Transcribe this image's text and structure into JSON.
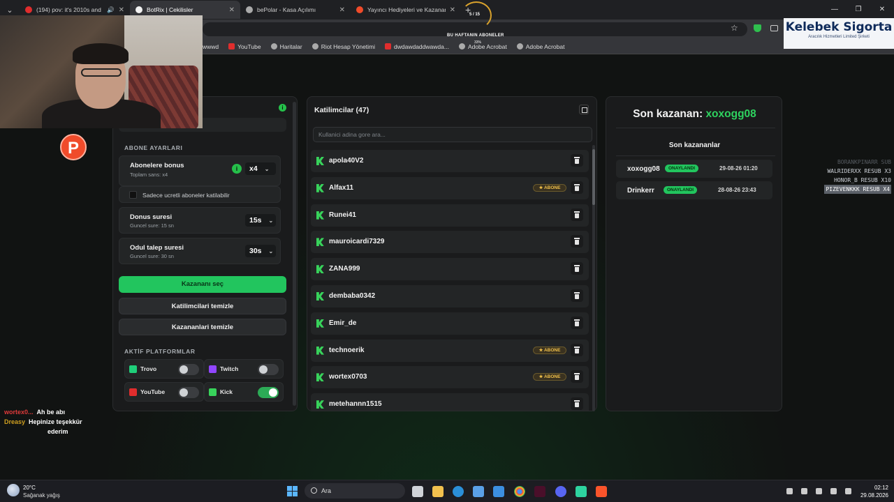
{
  "browser": {
    "tabs": [
      {
        "title": "(194) pov: it's 2010s and y...",
        "color": "#e02d2d",
        "active": false
      },
      {
        "title": "BotRix | Cekilisler",
        "color": "#f2f2f2",
        "active": true
      },
      {
        "title": "bePolar - Kasa Açılımı",
        "color": "#aaaaaa",
        "active": false
      },
      {
        "title": "Yayıncı Hediyeleri ve Kazananlar",
        "color": "#f04b2a",
        "active": false
      }
    ],
    "new_tab": "+",
    "bookmarks": [
      {
        "label": "wwwd",
        "icon": "globe-icon"
      },
      {
        "label": "YouTube",
        "icon": "youtube-icon"
      },
      {
        "label": "Haritalar",
        "icon": "globe-icon"
      },
      {
        "label": "Riot Hesap Yönetimi",
        "icon": "riot-icon"
      },
      {
        "label": "dwdawdaddwawda...",
        "icon": "youtube-icon"
      },
      {
        "label": "Adobe Acrobat",
        "icon": "globe-icon"
      },
      {
        "label": "Adobe Acrobat",
        "icon": "globe-icon"
      }
    ]
  },
  "overlay": {
    "subs_goal_count": "5 / 15",
    "subs_goal_title": "BU HAFTANIN ABONELER",
    "subs_goal_pct": "33%",
    "sponsor_name": "Kelebek Sigorta",
    "sponsor_sub": "Aracılık Hizmetleri Limited Şirketi",
    "resubs": [
      "BORANKPINARR SUB",
      "WALRIDERXX RESUB X3",
      "HONOR_B RESUB X10",
      "PIZEVENKKK RESUB X4"
    ],
    "chat": [
      {
        "user": "wortex0...",
        "message": "Ah be abı"
      },
      {
        "user": "Dreasy",
        "message": "Hepinize teşekkür"
      },
      {
        "user": "",
        "message": "ederim"
      }
    ]
  },
  "settings": {
    "section_title": "ABONE AYARLARI",
    "bonus": {
      "title": "Abonelere bonus",
      "subtitle": "Toplam sans: x4",
      "value": "x4"
    },
    "paid_only_label": "Sadece ucretli aboneler katilabilir",
    "bonus_time": {
      "title": "Donus suresi",
      "subtitle": "Guncel sure: 15 sn",
      "value": "15s"
    },
    "claim_time": {
      "title": "Odul talep suresi",
      "subtitle": "Guncel sure: 30 sn",
      "value": "30s"
    },
    "pick_winner": "Kazananı seç",
    "clear_participants": "Katilimcilari temizle",
    "clear_winners": "Kazananlari temizle",
    "platforms_title": "AKTİF PLATFORMLAR",
    "platforms": [
      {
        "name": "Trovo",
        "color": "#1fcf7a",
        "enabled": false
      },
      {
        "name": "Twitch",
        "color": "#9146ff",
        "enabled": false
      },
      {
        "name": "YouTube",
        "color": "#e02d2d",
        "enabled": false
      },
      {
        "name": "Kick",
        "color": "#38d35b",
        "enabled": true
      }
    ]
  },
  "participants": {
    "title": "Katilimcilar (47)",
    "search_placeholder": "Kullanici adina gore ara...",
    "subscriber_badge": "★ ABONE",
    "list": [
      {
        "name": "apola40V2",
        "subscriber": false
      },
      {
        "name": "Alfax11",
        "subscriber": true
      },
      {
        "name": "Runei41",
        "subscriber": false
      },
      {
        "name": "mauroicardi7329",
        "subscriber": false
      },
      {
        "name": "ZANA999",
        "subscriber": false
      },
      {
        "name": "dembaba0342",
        "subscriber": false
      },
      {
        "name": "Emir_de",
        "subscriber": false
      },
      {
        "name": "technoerik",
        "subscriber": true
      },
      {
        "name": "wortex0703",
        "subscriber": true
      },
      {
        "name": "metehannn1515",
        "subscriber": false
      }
    ]
  },
  "winners": {
    "last_label": "Son kazanan:",
    "last_name": "xoxogg08",
    "recent_title": "Son kazananlar",
    "approved_label": "ONAYLANDI",
    "list": [
      {
        "name": "xoxogg08",
        "date": "29-08-26 01:20"
      },
      {
        "name": "Drinkerr",
        "date": "28-08-26 23:43"
      }
    ]
  },
  "taskbar": {
    "temperature": "20°C",
    "weather": "Sağanak yağış",
    "search": "Ara",
    "time": "02:12",
    "date": "29.08.2026"
  },
  "colors": {
    "accent": "#22c55e",
    "kick": "#38d35b",
    "badge": "#f0c04a"
  }
}
